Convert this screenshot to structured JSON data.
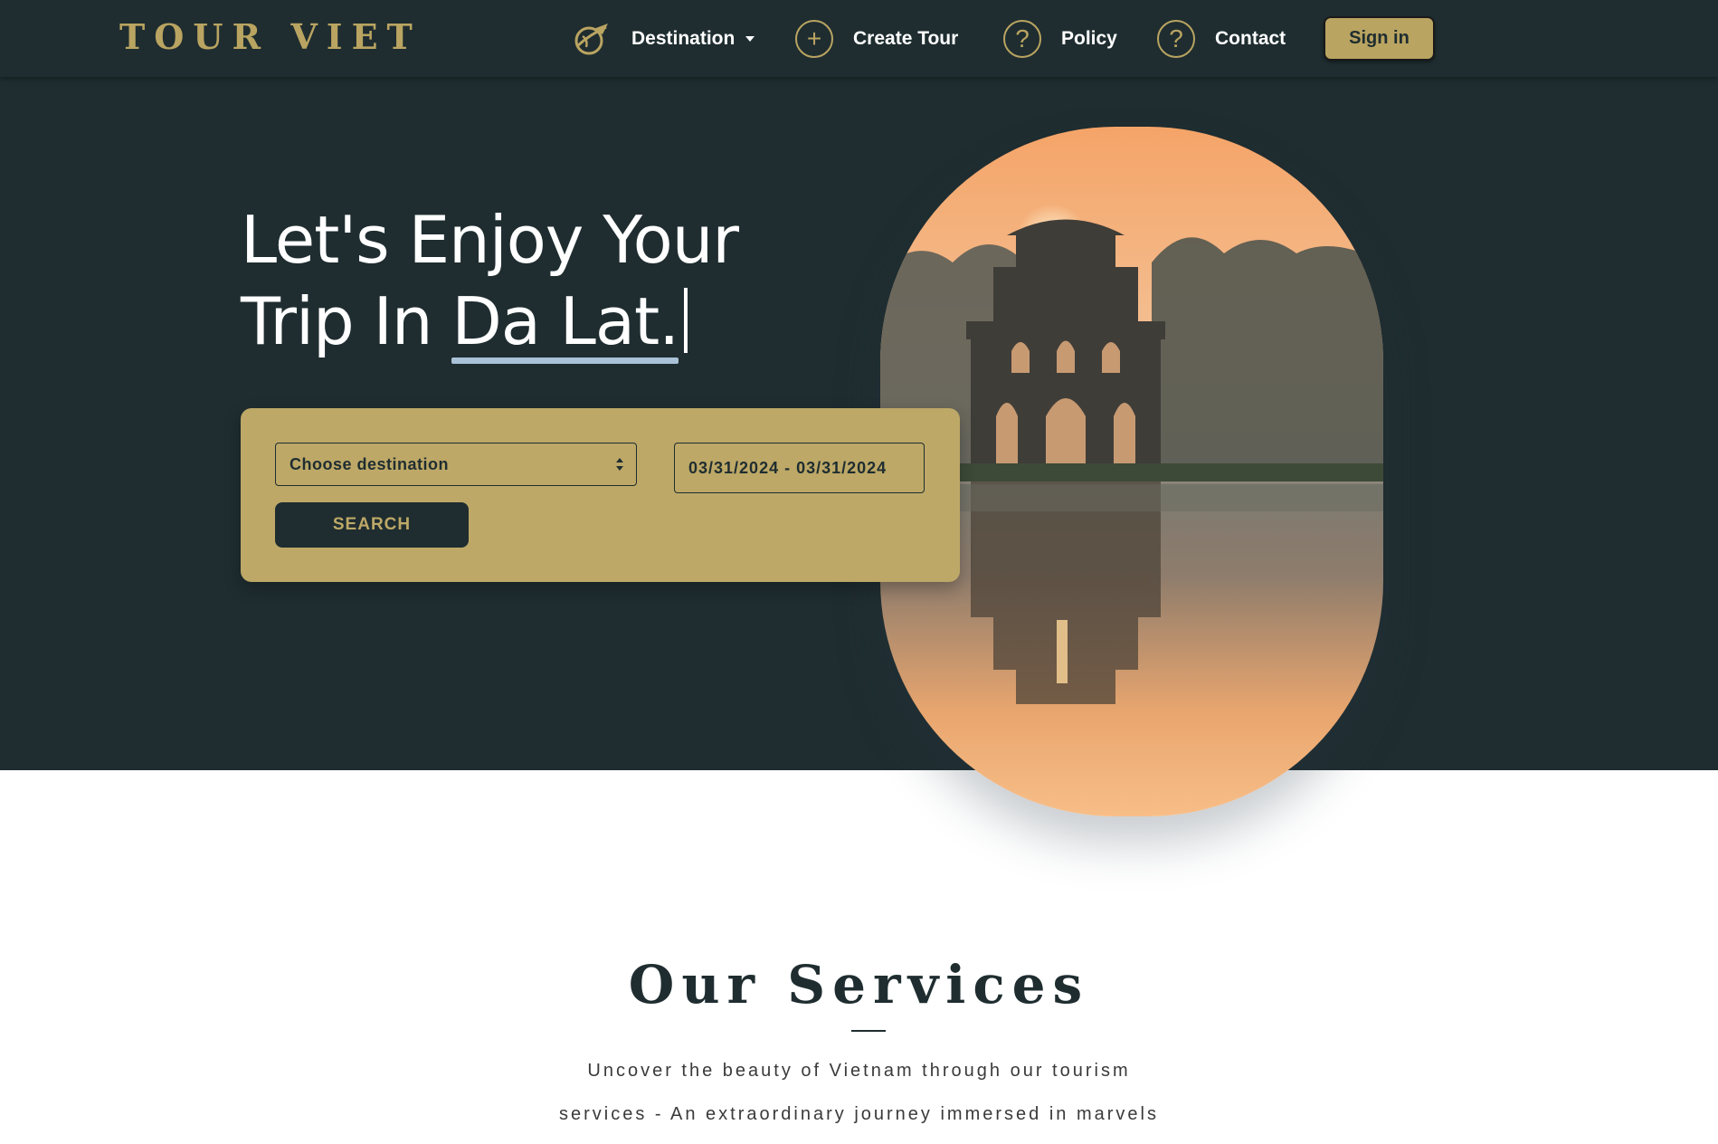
{
  "nav": {
    "brand": "TOUR VIET",
    "items": [
      {
        "label": "Destination",
        "icon": "plane-globe-icon"
      },
      {
        "label": "Create Tour",
        "icon": "plus-circle-icon"
      },
      {
        "label": "Policy",
        "icon": "question-circle-icon"
      },
      {
        "label": "Contact",
        "icon": "question-circle-icon"
      }
    ],
    "signin_label": "Sign in"
  },
  "hero": {
    "line1": "Let's Enjoy Your",
    "line2_prefix": "Trip In ",
    "line2_accent": "Da Lat."
  },
  "search": {
    "destination_placeholder": "Choose destination",
    "date_range": "03/31/2024 - 03/31/2024",
    "button_label": "SEARCH"
  },
  "services": {
    "title": "Our Services",
    "line1": "Uncover the beauty of Vietnam through our tourism",
    "line2": "services - An extraordinary journey immersed in marvels"
  },
  "colors": {
    "dark": "#1f2d30",
    "gold": "#b9a461",
    "card": "#bda867",
    "underline": "#a9c2d8"
  }
}
